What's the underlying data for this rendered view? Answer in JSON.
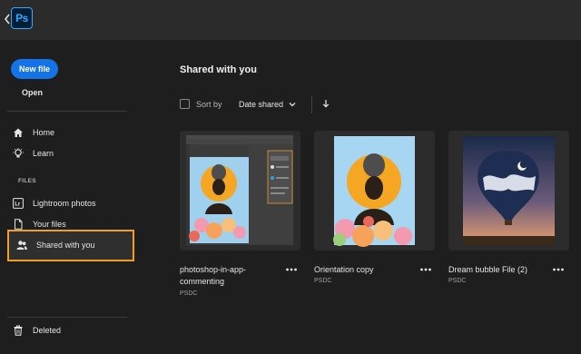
{
  "app": {
    "logo_text": "Ps"
  },
  "sidebar": {
    "new_file": "New file",
    "open": "Open",
    "nav": [
      {
        "label": "Home",
        "icon": "home-icon"
      },
      {
        "label": "Learn",
        "icon": "lightbulb-icon"
      }
    ],
    "files_section_label": "FILES",
    "files": [
      {
        "label": "Lightroom photos",
        "icon": "lightroom-icon",
        "icon_text": "Lr"
      },
      {
        "label": "Your files",
        "icon": "document-icon"
      },
      {
        "label": "Shared with you",
        "icon": "people-icon",
        "selected": true
      }
    ],
    "deleted": "Deleted"
  },
  "main": {
    "title": "Shared with you",
    "sort": {
      "label": "Sort by",
      "value": "Date shared"
    },
    "cards": [
      {
        "name": "photoshop-in-app-commenting",
        "name_line1": "photoshop-in-app-",
        "name_line2": "commenting",
        "type": "PSDC"
      },
      {
        "name": "Orientation copy",
        "type": "PSDC"
      },
      {
        "name": "Dream bubble File (2)",
        "type": "PSDC"
      }
    ]
  },
  "colors": {
    "accent_blue": "#1473e6",
    "highlight_orange": "#f29e25",
    "ps_blue": "#31a8ff"
  }
}
